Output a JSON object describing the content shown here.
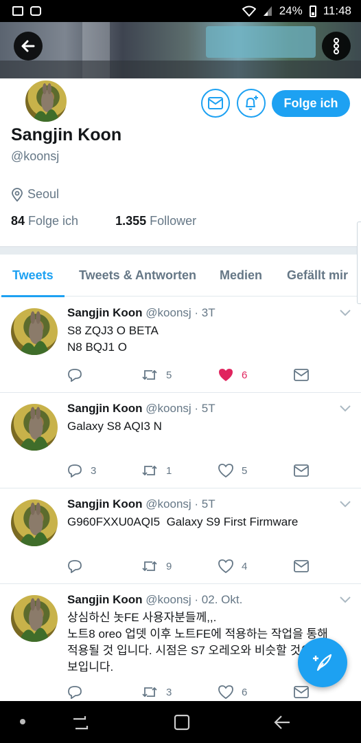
{
  "status_bar": {
    "battery": "24%",
    "time": "11:48",
    "icons_left": [
      "mail-icon",
      "instagram-icon"
    ],
    "icons_right": [
      "wifi-icon",
      "signal-icon",
      "battery-icon"
    ]
  },
  "profile": {
    "name": "Sangjin Koon",
    "handle": "@koonsj",
    "location": "Seoul",
    "following_count": "84",
    "following_label": "Folge ich",
    "followers_count": "1.355",
    "followers_label": "Follower",
    "follow_button": "Folge ich"
  },
  "tabs": [
    {
      "label": "Tweets",
      "active": true
    },
    {
      "label": "Tweets & Antworten",
      "active": false
    },
    {
      "label": "Medien",
      "active": false
    },
    {
      "label": "Gefällt mir",
      "active": false
    }
  ],
  "tweets": [
    {
      "name": "Sangjin Koon",
      "meta": "@koonsj · 3T",
      "lines": [
        "S8 ZQJ3 O BETA",
        "N8 BQJ1 O"
      ],
      "replies": "",
      "retweets": "5",
      "likes": "6",
      "liked": true
    },
    {
      "name": "Sangjin Koon",
      "meta": "@koonsj · 5T",
      "lines": [
        "Galaxy S8 AQI3 N"
      ],
      "replies": "3",
      "retweets": "1",
      "likes": "5",
      "liked": false
    },
    {
      "name": "Sangjin Koon",
      "meta": "@koonsj · 5T",
      "lines": [
        "G960FXXU0AQI5  Galaxy S9 First Firmware"
      ],
      "replies": "",
      "retweets": "9",
      "likes": "4",
      "liked": false
    },
    {
      "name": "Sangjin Koon",
      "meta": "@koonsj · 02. Okt.",
      "lines": [
        "상심하신 놋FE 사용자분들께,,.",
        "노트8 oreo 업뎃 이후 노트FE에 적용하는 작업을 통해",
        "적용될 것 입니다. 시점은 S7 오레오와 비슷할 것으로",
        "보입니다."
      ],
      "replies": "",
      "retweets": "3",
      "likes": "6",
      "liked": false
    }
  ],
  "colors": {
    "accent": "#1da1f2",
    "like": "#e0245e",
    "muted": "#657786"
  }
}
